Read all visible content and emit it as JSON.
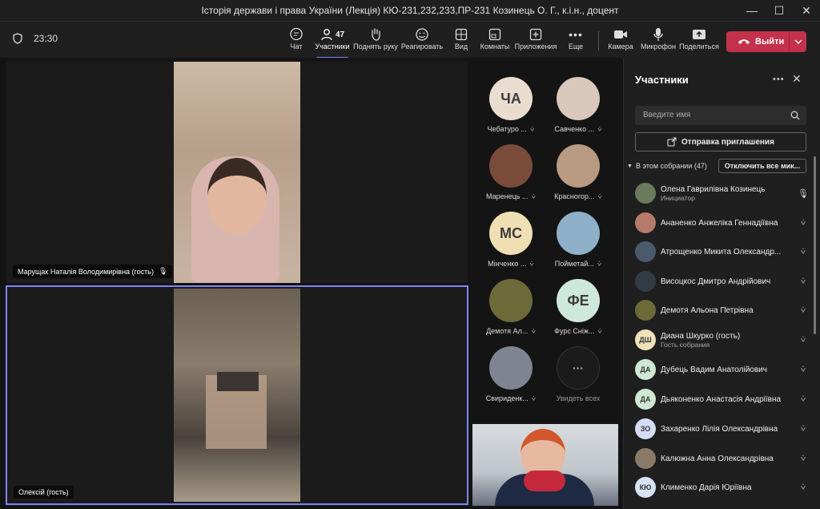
{
  "window": {
    "title": "Історія держави і права України (Лекція) КЮ-231,232,233,ПР-231 Козинець О. Г., к.і.н., доцент"
  },
  "toolbar": {
    "timer": "23:30",
    "chat": "Чат",
    "participants": "Участники",
    "participants_count": "47",
    "raise_hand": "Поднять руку",
    "react": "Реагировать",
    "view": "Вид",
    "rooms": "Комнаты",
    "apps": "Приложения",
    "more": "Еще",
    "camera": "Камера",
    "mic": "Микрофон",
    "share": "Поделиться",
    "leave": "Выйти"
  },
  "stage": {
    "tile1_name": "Марущак Наталія Володимирівна (гость)",
    "tile2_name": "Олексій (гость)"
  },
  "gallery": [
    {
      "initials": "ЧА",
      "name": "Чебатуро ...",
      "color": "#e9ddd0"
    },
    {
      "initials": "",
      "name": "Савченко ...",
      "color": "#d9c8bb"
    },
    {
      "initials": "",
      "name": "Маренець ...",
      "color": "#7a4a3a"
    },
    {
      "initials": "",
      "name": "Красногор...",
      "color": "#b99a82"
    },
    {
      "initials": "МС",
      "name": "Мінченко ...",
      "color": "#f1dfb4"
    },
    {
      "initials": "",
      "name": "Пойметай...",
      "color": "#8fb0c9"
    },
    {
      "initials": "",
      "name": "Демотя Ал...",
      "color": "#6d6a3a"
    },
    {
      "initials": "ФЕ",
      "name": "Фурс Сніж...",
      "color": "#cfe8dc"
    },
    {
      "initials": "",
      "name": "Свириденк...",
      "color": "#7e8590"
    },
    {
      "initials": "···",
      "name": "Увидеть всех",
      "color": "#1b1b1b"
    }
  ],
  "panel": {
    "title": "Участники",
    "search_placeholder": "Введите имя",
    "invite": "Отправка приглашения",
    "section": "В этом собрании (47)",
    "mute_all": "Отключить все мик...",
    "participants": [
      {
        "initials": "",
        "name": "Олена Гаврилівна Козинець",
        "role": "Инициатор",
        "color": "#6a7a5a",
        "mic": "on"
      },
      {
        "initials": "",
        "name": "Ананенко Анжеліка Геннадіївна",
        "role": "",
        "color": "#b47a6a",
        "mic": "off"
      },
      {
        "initials": "",
        "name": "Атрощенко Микита Олександр...",
        "role": "",
        "color": "#4a5a6a",
        "mic": "off"
      },
      {
        "initials": "",
        "name": "Висоцкос Дмитро Андрійович",
        "role": "",
        "color": "#333b44",
        "mic": "off"
      },
      {
        "initials": "",
        "name": "Демотя Альона Петрівна",
        "role": "",
        "color": "#6d6a3a",
        "mic": "off"
      },
      {
        "initials": "ДШ",
        "name": "Диана Шкурко (гость)",
        "role": "Гость собрания",
        "color": "#f0e2b8",
        "mic": "off"
      },
      {
        "initials": "ДА",
        "name": "Дубець Вадим Анатолійович",
        "role": "",
        "color": "#cfe8d4",
        "mic": "off"
      },
      {
        "initials": "ДА",
        "name": "Дьяконенко Анастасія Андріївна",
        "role": "",
        "color": "#cfe8d4",
        "mic": "off"
      },
      {
        "initials": "ЗО",
        "name": "Захаренко Лілія Олександрівна",
        "role": "",
        "color": "#d7dcf5",
        "mic": "off"
      },
      {
        "initials": "",
        "name": "Калюжна Анна Олександрівна",
        "role": "",
        "color": "#8a7a6a",
        "mic": "off"
      },
      {
        "initials": "КЮ",
        "name": "Клименко Дарія Юріївна",
        "role": "",
        "color": "#d7e3f5",
        "mic": "off"
      }
    ]
  }
}
